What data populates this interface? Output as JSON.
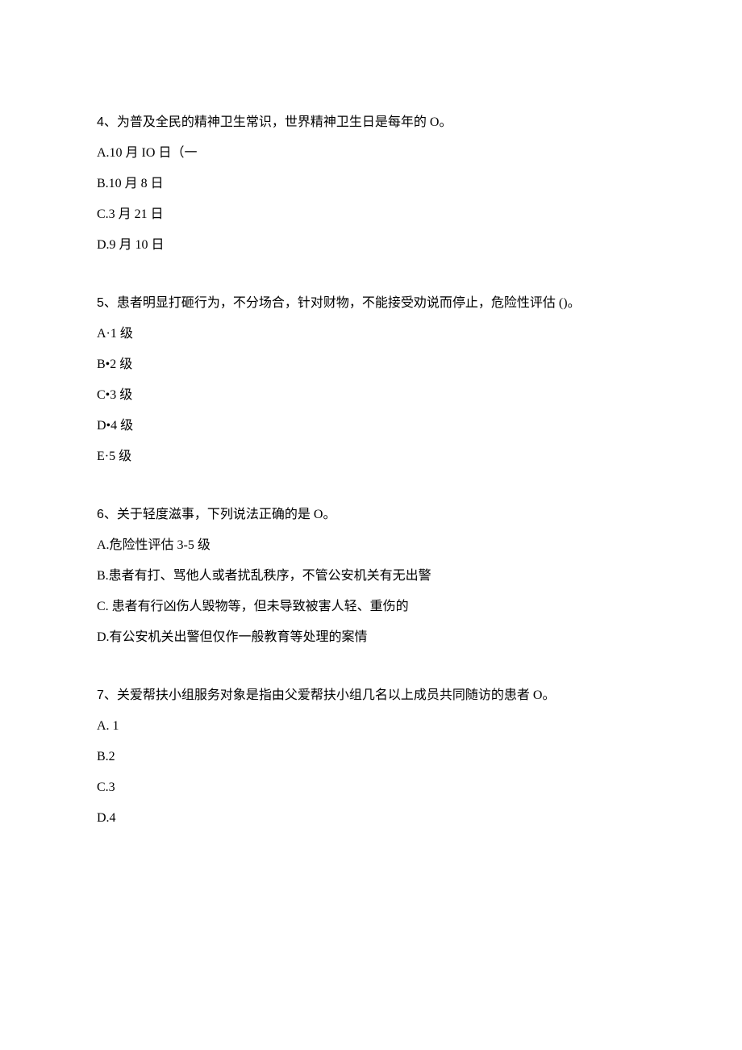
{
  "questions": [
    {
      "number": "4",
      "text": "、为普及全民的精神卫生常识，世界精神卫生日是每年的 O。",
      "options": [
        {
          "label": "A.10 月 IO 日（一"
        },
        {
          "label": "B.10 月 8 日"
        },
        {
          "label": "C.3 月 21 日"
        },
        {
          "label": "D.9 月 10 日"
        }
      ]
    },
    {
      "number": "5",
      "text": "、患者明显打砸行为，不分场合，针对财物，不能接受劝说而停止，危险性评估 ()。",
      "options": [
        {
          "label": "A·1 级"
        },
        {
          "label": "B•2 级"
        },
        {
          "label": "C•3 级"
        },
        {
          "label": "D•4 级"
        },
        {
          "label": "E·5 级"
        }
      ]
    },
    {
      "number": "6",
      "text": "、关于轻度滋事，下列说法正确的是 O。",
      "options": [
        {
          "label": "A.危险性评估 3-5 级"
        },
        {
          "label": "B.患者有打、骂他人或者扰乱秩序，不管公安机关有无出警"
        },
        {
          "label": "C. 患者有行凶伤人毁物等，但未导致被害人轻、重伤的"
        },
        {
          "label": "D.有公安机关出警但仅作一般教育等处理的案情"
        }
      ]
    },
    {
      "number": "7",
      "text": "、关爱帮扶小组服务对象是指由父爱帮扶小组几名以上成员共同随访的患者 O。",
      "options": [
        {
          "label": "A.   1"
        },
        {
          "label": "B.2"
        },
        {
          "label": "C.3"
        },
        {
          "label": "D.4"
        }
      ]
    }
  ]
}
